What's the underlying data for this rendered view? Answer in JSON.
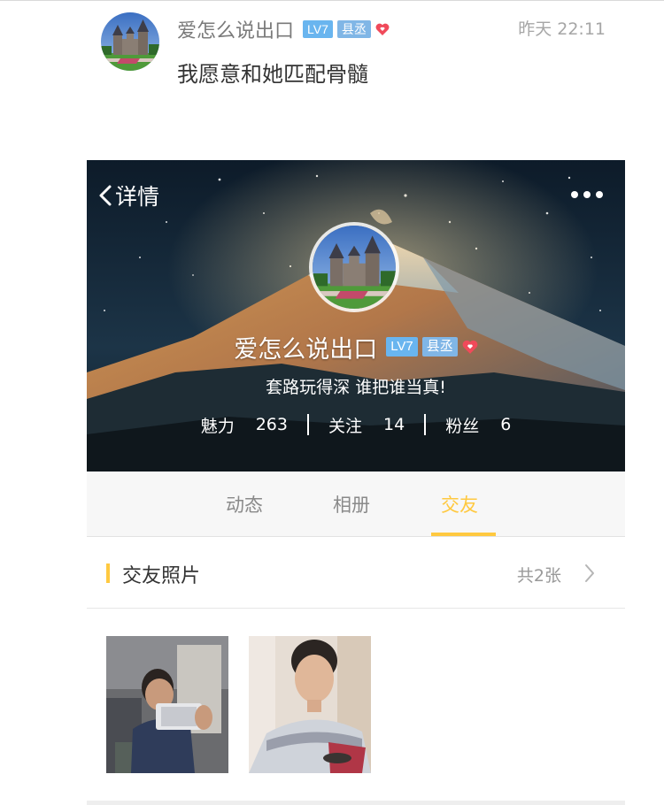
{
  "post": {
    "username": "爱怎么说出口",
    "level_badge": "LV7",
    "region_badge": "县丞",
    "time": "昨天 22:11",
    "text": "我愿意和她匹配骨髓"
  },
  "card": {
    "nav": {
      "back_label": "详情"
    },
    "profile": {
      "name": "爱怎么说出口",
      "level_badge": "LV7",
      "region_badge": "县丞",
      "motto": "套路玩得深 谁把谁当真!",
      "stats": [
        {
          "label": "魅力",
          "value": "263"
        },
        {
          "label": "关注",
          "value": "14"
        },
        {
          "label": "粉丝",
          "value": "6"
        }
      ]
    },
    "tabs": [
      {
        "label": "动态",
        "active": false
      },
      {
        "label": "相册",
        "active": false
      },
      {
        "label": "交友",
        "active": true
      }
    ],
    "section": {
      "title": "交友照片",
      "count": "共2张"
    },
    "photos": [
      {
        "name": "photo-1"
      },
      {
        "name": "photo-2"
      }
    ]
  },
  "colors": {
    "accent": "#ffc940",
    "level_badge": "#69b5ef",
    "region_badge": "#80b6e6",
    "heart": "#f04a5a"
  }
}
